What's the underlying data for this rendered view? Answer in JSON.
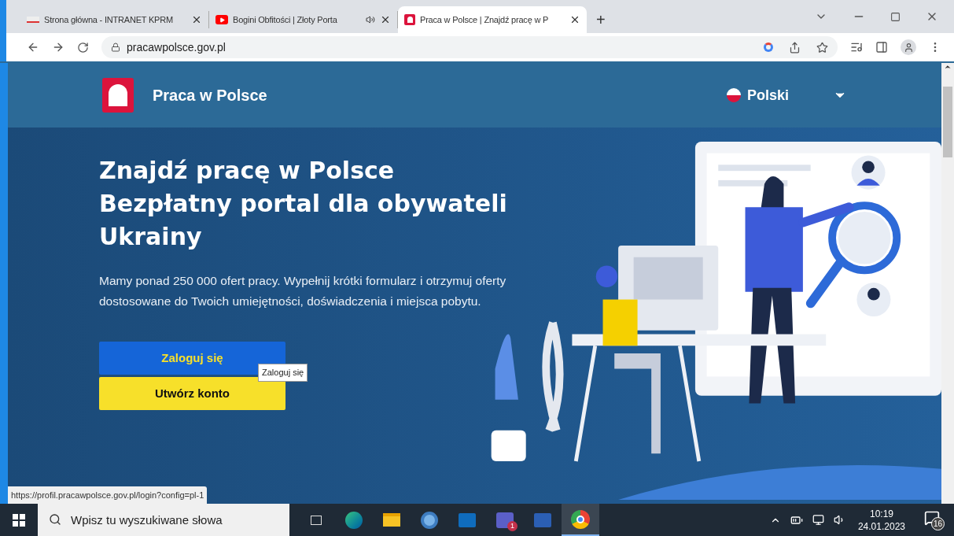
{
  "browser": {
    "tabs": [
      {
        "title": "Strona główna - INTRANET KPRM",
        "kind": "kprm",
        "audio": false,
        "selected": false
      },
      {
        "title": "Bogini Obfitości | Złoty Porta",
        "kind": "video",
        "audio": true,
        "selected": false
      },
      {
        "title": "Praca w Polsce | Znajdź pracę w P",
        "kind": "eagle",
        "audio": false,
        "selected": true
      }
    ],
    "new_tab": "+",
    "address": "pracawpolsce.gov.pl"
  },
  "page": {
    "brand": "Praca w Polsce",
    "language": "Polski",
    "hero": {
      "title_lines": [
        "Znajdź pracę w Polsce",
        "Bezpłatny portal dla obywateli",
        "Ukrainy"
      ],
      "text": "Mamy ponad 250 000 ofert pracy. Wypełnij krótki formularz i otrzymuj oferty dostosowane do Twoich umiejętności, doświadczenia i miejsca pobytu.",
      "buttons": [
        {
          "label": "Zaloguj się",
          "kind": "primary"
        },
        {
          "label": "Utwórz konto",
          "kind": "secondary"
        }
      ],
      "tooltip": "Zaloguj się"
    }
  },
  "status_url": "https://profil.pracawpolsce.gov.pl/login?config=pl-1",
  "taskbar": {
    "search_placeholder": "Wpisz tu wyszukiwane słowa",
    "apps": [
      {
        "kind": "taskview",
        "active": false
      },
      {
        "kind": "edge",
        "active": false
      },
      {
        "kind": "explorer",
        "active": false
      },
      {
        "kind": "media",
        "active": false
      },
      {
        "kind": "outlook",
        "active": false
      },
      {
        "kind": "teams",
        "active": false,
        "badge": "1"
      },
      {
        "kind": "word",
        "active": false
      },
      {
        "kind": "chrome",
        "active": true
      }
    ],
    "time": "10:19",
    "date": "24.01.2023",
    "notifications": "16"
  }
}
